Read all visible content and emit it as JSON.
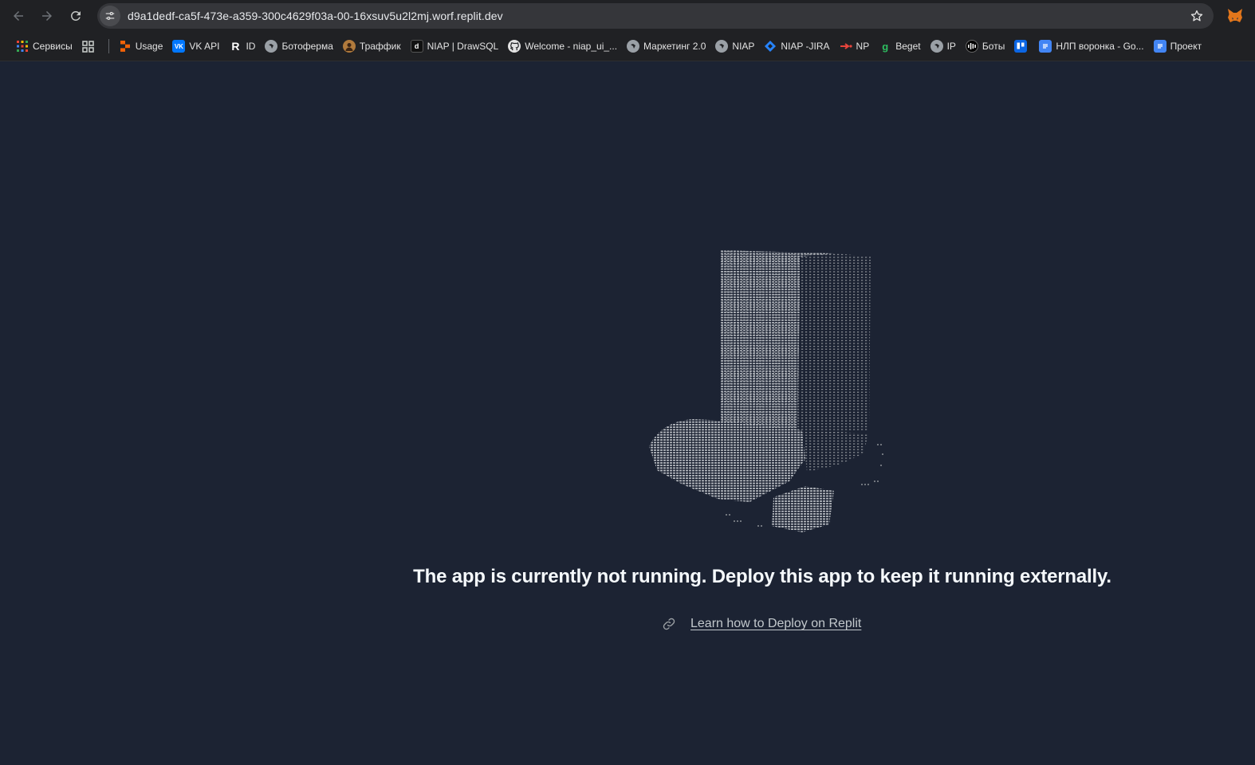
{
  "browser": {
    "url": "d9a1dedf-ca5f-473e-a359-300c4629f03a-00-16xsuv5u2l2mj.worf.replit.dev",
    "bookmarks": [
      {
        "label": "Сервисы",
        "icon": "apps-grid-icon",
        "color": "#ea4335"
      },
      {
        "label": "",
        "icon": "tab-groups-icon",
        "color": "#9aa0a6"
      },
      {
        "label": "Usage",
        "icon": "replit-icon",
        "color": "#f26207"
      },
      {
        "label": "VK API",
        "icon": "vk-icon",
        "color": "#0077ff"
      },
      {
        "label": "ID",
        "icon": "r-letter-icon",
        "color": "#ffffff"
      },
      {
        "label": "Ботоферма",
        "icon": "globe-icon",
        "color": "#9aa0a6"
      },
      {
        "label": "Траффик",
        "icon": "avatar-icon",
        "color": "#b07a3c"
      },
      {
        "label": "NIAP | DrawSQL",
        "icon": "drawsql-icon",
        "color": "#111111"
      },
      {
        "label": "Welcome - niap_ui_...",
        "icon": "github-icon",
        "color": "#e3e3e3"
      },
      {
        "label": "Маркетинг 2.0",
        "icon": "globe-icon",
        "color": "#9aa0a6"
      },
      {
        "label": "NIAP",
        "icon": "globe-icon",
        "color": "#9aa0a6"
      },
      {
        "label": "NIAP -JIRA",
        "icon": "jira-icon",
        "color": "#2684ff"
      },
      {
        "label": "NP",
        "icon": "np-icon",
        "color": "#e8453c"
      },
      {
        "label": "Beget",
        "icon": "beget-icon",
        "color": "#2dbe60"
      },
      {
        "label": "IP",
        "icon": "globe-icon",
        "color": "#9aa0a6"
      },
      {
        "label": "Боты",
        "icon": "bots-icon",
        "color": "#000000"
      },
      {
        "label": "",
        "icon": "trello-icon",
        "color": "#0c66e4"
      },
      {
        "label": "НЛП воронка - Go...",
        "icon": "google-docs-icon",
        "color": "#4285f4"
      },
      {
        "label": "Проект",
        "icon": "google-docs-icon",
        "color": "#4285f4"
      }
    ]
  },
  "page": {
    "message": "The app is currently not running. Deploy this app to keep it running externally.",
    "link_label": "Learn how to Deploy on Replit",
    "background": "#1c2333"
  }
}
